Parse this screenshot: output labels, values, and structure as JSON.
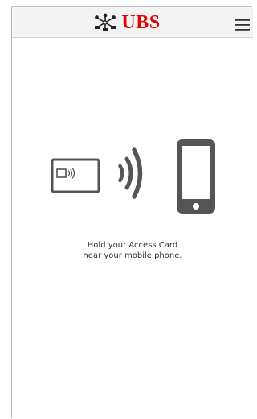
{
  "header": {
    "brand_name": "UBS",
    "logo_icon": "ubs-keys-icon",
    "menu_icon": "hamburger-menu-icon",
    "brand_color": "#e60000"
  },
  "main": {
    "instruction_line1": "Hold your Access Card",
    "instruction_line2": "near your mobile phone.",
    "icons": [
      "access-card-icon",
      "contactless-waves-icon",
      "mobile-phone-icon"
    ],
    "icon_color": "#555555"
  }
}
